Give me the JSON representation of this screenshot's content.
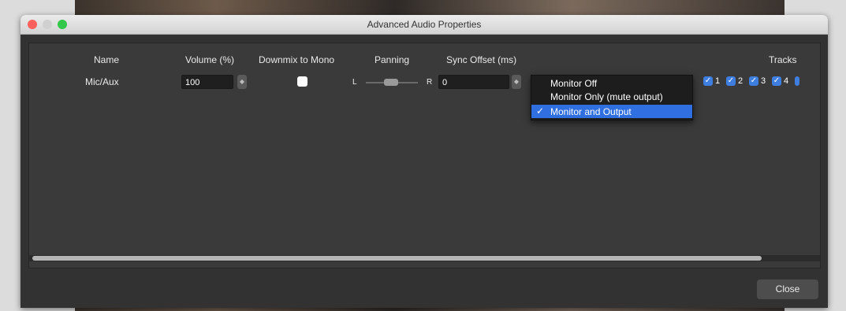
{
  "window": {
    "title": "Advanced Audio Properties"
  },
  "columns": {
    "name": "Name",
    "volume": "Volume (%)",
    "downmix": "Downmix to Mono",
    "panning": "Panning",
    "sync_offset": "Sync Offset (ms)",
    "tracks": "Tracks"
  },
  "row": {
    "name": "Mic/Aux",
    "volume": "100",
    "downmix_checked": false,
    "pan_left": "L",
    "pan_right": "R",
    "sync_offset": "0",
    "monitoring_selected": "Monitor and Output",
    "tracks": [
      {
        "label": "1",
        "checked": true
      },
      {
        "label": "2",
        "checked": true
      },
      {
        "label": "3",
        "checked": true
      },
      {
        "label": "4",
        "checked": true
      }
    ]
  },
  "monitoring_dropdown": {
    "options": [
      "Monitor Off",
      "Monitor Only (mute output)",
      "Monitor and Output"
    ],
    "selected_index": 2
  },
  "footer": {
    "close_label": "Close"
  },
  "colors": {
    "accent": "#2f6fe0",
    "panel": "#323232"
  }
}
